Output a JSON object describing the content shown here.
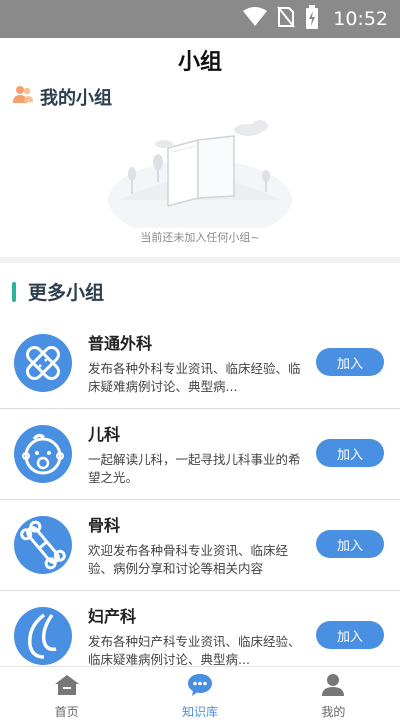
{
  "status_bar": {
    "time": "10:52"
  },
  "page": {
    "title": "小组"
  },
  "my_groups": {
    "heading": "我的小组",
    "empty_text": "当前还未加入任何小组~"
  },
  "more_groups": {
    "heading": "更多小组",
    "items": [
      {
        "name": "普通外科",
        "desc": "发布各种外科专业资讯、临床经验、临床疑难病例讨论、典型病...",
        "join": "加入",
        "icon": "bandage-icon"
      },
      {
        "name": "儿科",
        "desc": "一起解读儿科，一起寻找儿科事业的希望之光。",
        "join": "加入",
        "icon": "baby-icon"
      },
      {
        "name": "骨科",
        "desc": "欢迎发布各种骨科专业资讯、临床经验、病例分享和讨论等相关内容",
        "join": "加入",
        "icon": "bone-icon"
      },
      {
        "name": "妇产科",
        "desc": "发布各种妇产科专业资讯、临床经验、临床疑难病例讨论、典型病...",
        "join": "加入",
        "icon": "obstetrics-icon"
      }
    ]
  },
  "bottom_nav": {
    "items": [
      {
        "label": "首页",
        "icon": "home-icon",
        "active": false
      },
      {
        "label": "知识库",
        "icon": "chat-icon",
        "active": true
      },
      {
        "label": "我的",
        "icon": "user-icon",
        "active": false
      }
    ]
  },
  "colors": {
    "accent": "#4a90e2",
    "section_bar": "#2bb39a",
    "status_bar": "#8a8a8a"
  }
}
